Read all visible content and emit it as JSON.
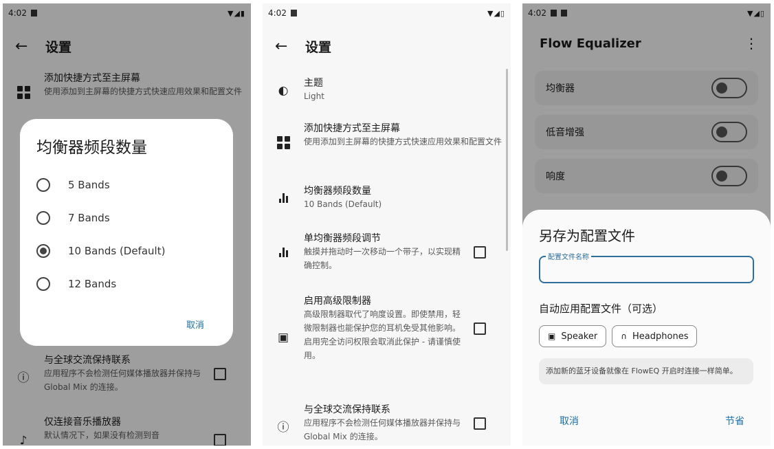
{
  "screen1": {
    "status": {
      "time": "4:02",
      "sys_icons": "▼◢▮"
    },
    "appbar": {
      "back_icon": "arrow-left-icon",
      "title": "设置"
    },
    "items": [
      {
        "title": "添加快捷方式至主屏幕",
        "subtitle": "使用添加到主屏幕的快捷方式快速应用效果和配置文件",
        "icon": "grid-icon"
      },
      {
        "title": "与全球交流保持联系",
        "subtitle": "应用程序不会检测任何媒体播放器并保持与 Global Mix 的连接。",
        "icon": "alert-icon"
      },
      {
        "title": "仅连接音乐播放器",
        "subtitle": "默认情况下，如果没有检测到音",
        "icon": "music-icon"
      }
    ],
    "dialog": {
      "title": "均衡器频段数量",
      "options": [
        {
          "label": "5 Bands",
          "selected": false
        },
        {
          "label": "7 Bands",
          "selected": false
        },
        {
          "label": "10 Bands (Default)",
          "selected": true
        },
        {
          "label": "12 Bands",
          "selected": false
        }
      ],
      "cancel": "取消"
    }
  },
  "screen2": {
    "status": {
      "time": "4:02",
      "sys_icons": "▼◢▯"
    },
    "appbar": {
      "back_icon": "arrow-left-icon",
      "title": "设置"
    },
    "items": [
      {
        "title": "主题",
        "subtitle": "Light",
        "icon": "contrast-icon"
      },
      {
        "title": "添加快捷方式至主屏幕",
        "subtitle": "使用添加到主屏幕的快捷方式快速应用效果和配置文件",
        "icon": "grid-icon"
      },
      {
        "title": "均衡器频段数量",
        "subtitle": "10 Bands (Default)",
        "icon": "equalizer-icon"
      },
      {
        "title": "单均衡器频段调节",
        "subtitle": "触摸并拖动时一次移动一个带子，以实现精确控制。",
        "icon": "equalizer-icon"
      },
      {
        "title": "启用高级限制器",
        "subtitle": "高级限制器取代了响度设置。即使禁用，轻微限制器也能保护您的耳机免受其他影响。启用完全访问权限会取消此保护 - 请谨慎使用。",
        "icon": "speaker-icon"
      },
      {
        "title": "与全球交流保持联系",
        "subtitle": "应用程序不会检测任何媒体播放器并保持与 Global Mix 的连接。",
        "icon": "alert-icon"
      }
    ]
  },
  "screen3": {
    "status": {
      "time": "4:02",
      "sys_icons": "▼◢▯"
    },
    "title": "Flow Equalizer",
    "menu_icon": "more-vert-icon",
    "cards": [
      {
        "label": "均衡器",
        "on": false
      },
      {
        "label": "低音增强",
        "on": false
      },
      {
        "label": "响度",
        "on": false
      }
    ],
    "sheet": {
      "title": "另存为配置文件",
      "field_label": "配置文件名称",
      "field_value": "",
      "auto_apply": "自动应用配置文件（可选）",
      "chips": [
        {
          "label": "Speaker",
          "icon": "speaker-icon"
        },
        {
          "label": "Headphones",
          "icon": "headphones-icon"
        }
      ],
      "note": "添加新的蓝牙设备就像在 FlowEQ 开启时连接一样简单。",
      "cancel": "取消",
      "save": "节省"
    }
  }
}
